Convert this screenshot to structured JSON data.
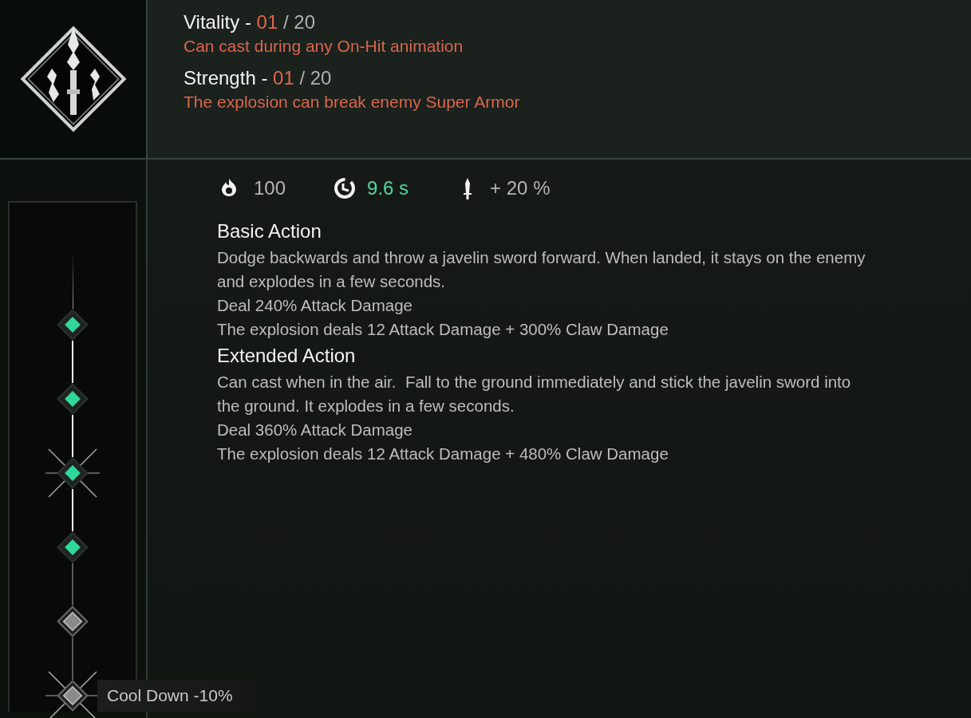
{
  "attributes": [
    {
      "name": "Vitality -",
      "value": "01",
      "slash": "/",
      "max": "20",
      "effect": "Can cast during any On-Hit animation"
    },
    {
      "name": "Strength -",
      "value": "01",
      "slash": "/",
      "max": "20",
      "effect": "The explosion can break enemy Super Armor"
    }
  ],
  "stats": [
    {
      "kind": "fire",
      "value": "100",
      "color": "#b4b4b0"
    },
    {
      "kind": "cooldown",
      "value": "9.6 s",
      "color": "#4fd7a0"
    },
    {
      "kind": "blade",
      "value": "+ 20 %",
      "color": "#b4b4b0"
    }
  ],
  "sections": [
    {
      "title": "Basic Action",
      "lines": [
        "Dodge backwards and throw a javelin sword forward. When landed, it stays on the enemy and explodes in a few seconds.",
        "Deal 240% Attack Damage",
        "The explosion deals 12 Attack Damage + 300% Claw Damage"
      ]
    },
    {
      "title": "Extended Action",
      "lines": [
        "Can cast when in the air.  Fall to the ground immediately and stick the javelin sword into the ground. It explodes in a few seconds.",
        "Deal 360% Attack Damage",
        "The explosion deals 12 Attack Damage + 480% Claw Damage"
      ]
    }
  ],
  "nodes": [
    {
      "unlocked": true,
      "sparkle": false
    },
    {
      "unlocked": true,
      "sparkle": false
    },
    {
      "unlocked": true,
      "sparkle": true
    },
    {
      "unlocked": true,
      "sparkle": false
    },
    {
      "unlocked": false,
      "sparkle": false
    },
    {
      "unlocked": false,
      "sparkle": true,
      "label": "Cool Down -10%"
    }
  ]
}
